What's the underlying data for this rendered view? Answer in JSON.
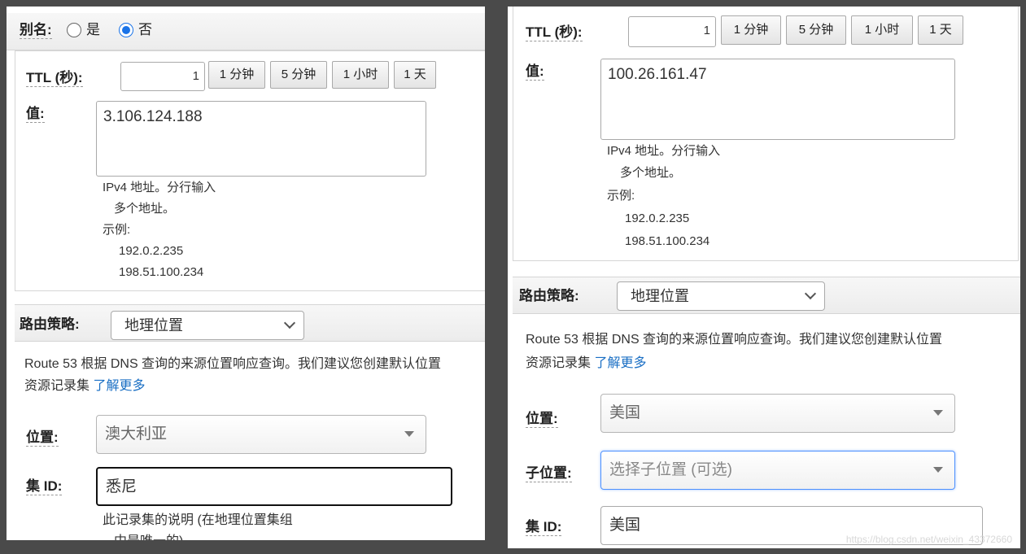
{
  "left": {
    "alias": {
      "label": "别名:",
      "yes": "是",
      "no": "否"
    },
    "ttl": {
      "label": "TTL (秒):",
      "value": "1",
      "btn_1m": "1 分钟",
      "btn_5m": "5 分钟",
      "btn_1h": "1 小时",
      "btn_1d": "1 天"
    },
    "value": {
      "label": "值:",
      "text": "3.106.124.188",
      "help": [
        "IPv4 地址。分行输入",
        "多个地址。",
        "示例:",
        "192.0.2.235",
        "198.51.100.234"
      ]
    },
    "routing": {
      "label": "路由策略:",
      "selected": "地理位置",
      "desc_line1": "Route 53 根据 DNS 查询的来源位置响应查询。我们建议您创建默认位置",
      "desc_line2": "资源记录集",
      "learn_more": "了解更多"
    },
    "location": {
      "label": "位置:",
      "value": "澳大利亚"
    },
    "set_id": {
      "label": "集 ID:",
      "value": "悉尼"
    },
    "set_id_help": [
      "此记录集的说明 (在地理位置集组",
      "中是唯一的)"
    ]
  },
  "right": {
    "ttl": {
      "label": "TTL (秒):",
      "value": "1",
      "btn_1m": "1 分钟",
      "btn_5m": "5 分钟",
      "btn_1h": "1 小时",
      "btn_1d": "1 天"
    },
    "value": {
      "label": "值:",
      "text": "100.26.161.47",
      "help": [
        "IPv4 地址。分行输入",
        "多个地址。",
        "示例:",
        "192.0.2.235",
        "198.51.100.234"
      ]
    },
    "routing": {
      "label": "路由策略:",
      "selected": "地理位置",
      "desc_line1": "Route 53 根据 DNS 查询的来源位置响应查询。我们建议您创建默认位置",
      "desc_line2": "资源记录集",
      "learn_more": "了解更多"
    },
    "location": {
      "label": "位置:",
      "value": "美国"
    },
    "sublocation": {
      "label": "子位置:",
      "placeholder": "选择子位置 (可选)"
    },
    "set_id": {
      "label": "集 ID:",
      "value": "美国"
    }
  },
  "watermark": "https://blog.csdn.net/weixin_43372660"
}
